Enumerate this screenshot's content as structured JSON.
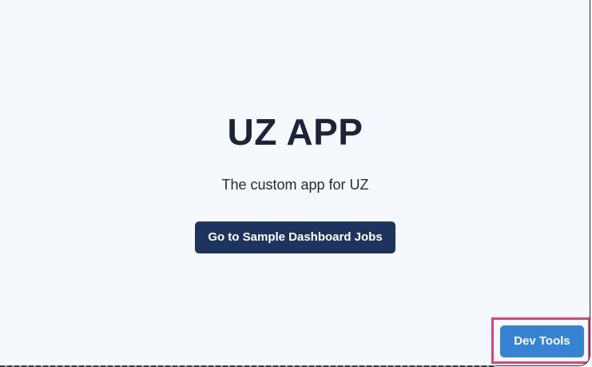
{
  "app": {
    "title": "UZ APP",
    "subtitle": "The custom app for UZ"
  },
  "actions": {
    "primary_label": "Go to Sample Dashboard Jobs",
    "devtools_label": "Dev Tools"
  },
  "colors": {
    "background": "#f5f9fd",
    "title_text": "#1c2537",
    "primary_button": "#1d355c",
    "devtools_button": "#3683d4",
    "highlight_border": "#e5407a"
  }
}
